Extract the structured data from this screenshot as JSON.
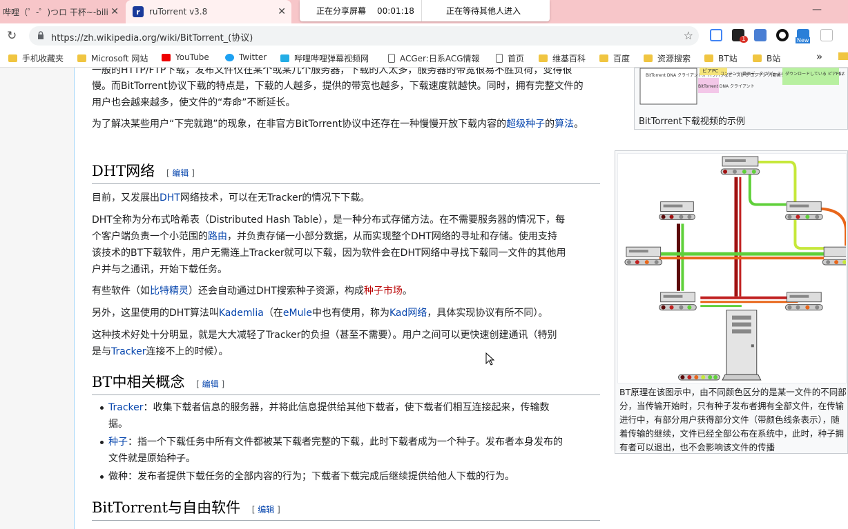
{
  "browser": {
    "tabs": [
      {
        "title": "哔哩（゜-゜)つロ 干杯~-bili"
      },
      {
        "title": "ruTorrent v3.8",
        "icon": "rutorrent-icon"
      },
      {
        "title": ""
      }
    ],
    "share_banner": {
      "sharing": "正在分享屏幕",
      "timer": "00:01:18",
      "waiting": "正在等待其他人进入"
    },
    "url": "https://zh.wikipedia.org/wiki/BitTorrent_(协议)",
    "extension_badge": "1",
    "extension_new_label": "New",
    "bookmarks": [
      {
        "label": "手机收藏夹",
        "icon": "folder"
      },
      {
        "label": "Microsoft 网站",
        "icon": "folder"
      },
      {
        "label": "YouTube",
        "icon": "youtube"
      },
      {
        "label": "Twitter",
        "icon": "twitter"
      },
      {
        "label": "哔哩哔哩弹幕视频网",
        "icon": "bilibili"
      },
      {
        "label": "ACGer:日系ACG情報",
        "icon": "doc"
      },
      {
        "label": "首页",
        "icon": "doc"
      },
      {
        "label": "维基百科",
        "icon": "folder"
      },
      {
        "label": "百度",
        "icon": "folder"
      },
      {
        "label": "资源搜索",
        "icon": "folder"
      },
      {
        "label": "BT站",
        "icon": "folder"
      },
      {
        "label": "B站",
        "icon": "folder"
      },
      {
        "label": "»",
        "icon": "none"
      }
    ]
  },
  "article": {
    "intro": {
      "line0": "一般的HTTP/FTP下载，发布文件仅在某个或某几个服务器，下载的人太多，服务器的带宽很易不胜负荷，变得很",
      "line1": "慢。而BitTorrent协议下载的特点是，下载的人越多，提供的带宽也越多，下载速度就越快。同时，拥有完整文件的",
      "line2": "用户也会越来越多，使文件的“寿命”不断延长。"
    },
    "superseed": {
      "pre": "为了解决某些用户“下完就跑”的现象，在非官方BitTorrent协议中还存在一种慢慢开放下载内容的",
      "link1": "超级种子",
      "mid": "的",
      "link2": "算法",
      "post": "。"
    },
    "dht": {
      "heading": "DHT网络",
      "edit": "编辑",
      "p1_pre": "目前，又发展出",
      "p1_link": "DHT",
      "p1_post": "网络技术，可以在无Tracker的情况下下载。",
      "p2_l1": "DHT全称为分布式哈希表（Distributed Hash Table），是一种分布式存储方法。在不需要服务器的情况下，每",
      "p2_l2_pre": "个客户端负责一个小范围的",
      "p2_l2_link": "路由",
      "p2_l2_post": "，并负责存储一小部分数据，从而实现整个DHT网络的寻址和存储。使用支持",
      "p2_l3": "该技术的BT下载软件，用户无需连上Tracker就可以下载，因为软件会在DHT网络中寻找下载同一文件的其他用",
      "p2_l4": "户并与之通讯，开始下载任务。",
      "p3_pre": "有些软件（如",
      "p3_link": "比特精灵",
      "p3_mid": "）还会自动通过DHT搜索种子资源，构成",
      "p3_red": "种子市场",
      "p3_post": "。",
      "p4_pre": "另外，这里使用的DHT算法叫",
      "p4_link1": "Kademlia",
      "p4_mid1": "（在",
      "p4_link2": "eMule",
      "p4_mid2": "中也有使用，称为",
      "p4_link3": "Kad网络",
      "p4_post": "，具体实现协议有所不同）。",
      "p5_l1": "这种技术好处十分明显，就是大大减轻了Tracker的负担（甚至不需要）。用户之间可以更快速创建通讯（特别",
      "p5_l2_pre": "是与",
      "p5_l2_link": "Tracker",
      "p5_l2_post": "连接不上的时候）。"
    },
    "bt_concepts": {
      "heading": "BT中相关概念",
      "edit": "编辑",
      "items": [
        {
          "term": "Tracker",
          "linked": true,
          "l1": "：收集下载者信息的服务器，并将此信息提供给其他下载者，使下载者们相互连接起来，传输数",
          "l2": "据。"
        },
        {
          "term": "种子",
          "linked": true,
          "l1": "：指一个下载任务中所有文件都被某下载者完整的下载，此时下载者成为一个种子。发布者本身发布的",
          "l2": "文件就是原始种子。"
        },
        {
          "term": "做种",
          "linked": false,
          "l1": "：发布者提供下载任务的全部内容的行为；下载者下载完成后继续提供给他人下载的行为。",
          "l2": ""
        }
      ]
    },
    "free_software": {
      "heading": "BitTorrent与自由软件",
      "edit": "编辑"
    }
  },
  "figures": {
    "fig1": {
      "caption": "BitTorrent下载视频的示例",
      "img_texts": [
        "BitTorrent DNA クライアントが バラバラなピースから コンテンツ(動画データ) を組み立てる。",
        "ビアPC",
        "BitTorrent DNA クライアント",
        "コンテンツ(動画データ)がピースに別れたまま PC間で交換される。",
        "ダウンロードしている ピアPCの集団"
      ]
    },
    "fig2": {
      "caption_l1": "BT原理在该图示中，由不同颜色区分的是某一文件的不同部",
      "caption_l2": "分，当传输开始时，只有种子发布者拥有全部文件，在传输",
      "caption_l3": "进行中，有部分用户获得部分文件（带颜色线条表示），随",
      "caption_l4": "着传输的继续，文件已经全部公布在系统中，此时，种子拥",
      "caption_l5": "有者可以退出，也不会影响该文件的传播"
    }
  },
  "colors": {
    "tab_bar": "#f7c6c9",
    "link": "#0645ad",
    "redlink": "#ba0000"
  }
}
